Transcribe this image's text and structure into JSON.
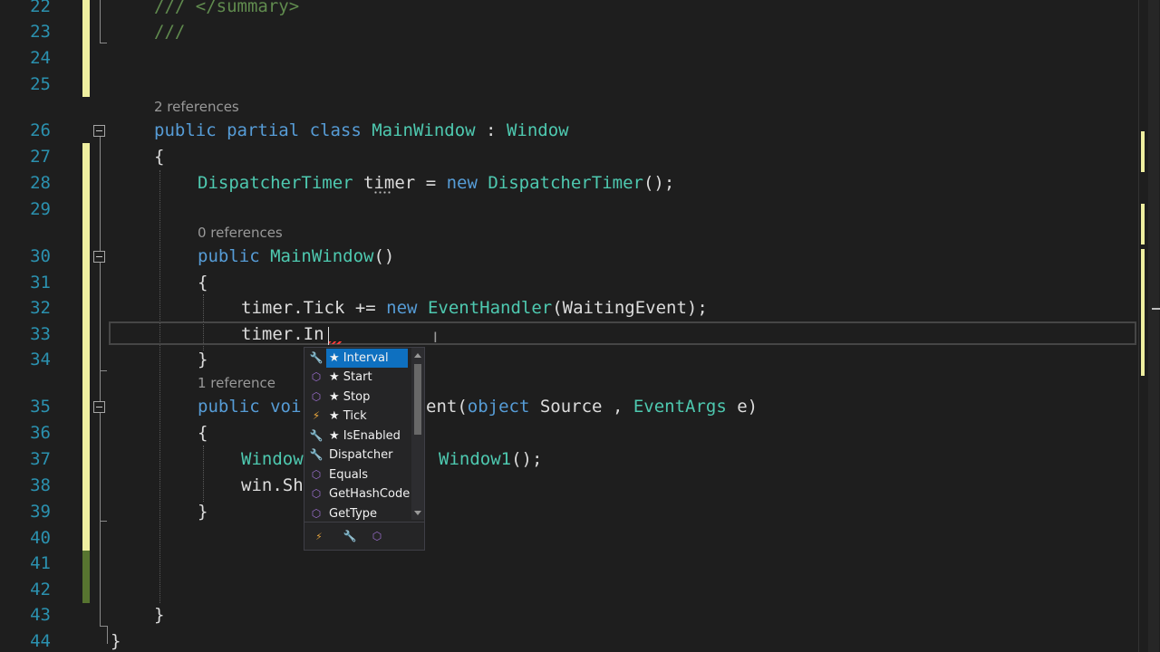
{
  "line_numbers": [
    "22",
    "23",
    "24",
    "25",
    "26",
    "27",
    "28",
    "29",
    "30",
    "31",
    "32",
    "33",
    "34",
    "35",
    "36",
    "37",
    "38",
    "39",
    "40",
    "41",
    "42",
    "43",
    "44"
  ],
  "code_lens": {
    "class_refs": "2 references",
    "ctor_refs": "0 references",
    "method_refs": "1 reference"
  },
  "code": {
    "l22": "/// </summary>",
    "l23": "///",
    "l26": {
      "kw": "public partial class ",
      "name": "MainWindow",
      "sep": " : ",
      "base": "Window"
    },
    "l27": "{",
    "l28": {
      "type": "DispatcherTimer",
      "ws": " ",
      "var": "timer",
      "eq": " = ",
      "kw": "new",
      "sp": " ",
      "ctor": "DispatcherTimer",
      "end": "();"
    },
    "l30": {
      "kw": "public",
      "sp": " ",
      "name": "MainWindow",
      "end": "()"
    },
    "l31": "{",
    "l32": {
      "obj": "timer",
      "rest": ".Tick += ",
      "kw": "new",
      "sp": " ",
      "type": "EventHandler",
      "end": "(WaitingEvent);"
    },
    "l33": "timer.In",
    "l34": "}",
    "l35": {
      "kw": "public",
      "sp": " ",
      "kw2": "voi",
      "tail1": "ent(",
      "kw3": "object",
      "sp2": " ",
      "p1": "Source",
      "mid": " , ",
      "type": "EventArgs",
      "end": " e)"
    },
    "l36": "{",
    "l37": {
      "type": "Window",
      "tail_type": "Window1",
      "end": "();"
    },
    "l38": "win.Sh",
    "l39": "}",
    "l43": "}",
    "l44": "}"
  },
  "intellisense": {
    "items": [
      {
        "label": "★ Interval",
        "icon": "wrench-icon",
        "selected": true
      },
      {
        "label": "★ Start",
        "icon": "method-icon",
        "selected": false
      },
      {
        "label": "★ Stop",
        "icon": "method-icon",
        "selected": false
      },
      {
        "label": "★ Tick",
        "icon": "event-icon",
        "selected": false
      },
      {
        "label": "★ IsEnabled",
        "icon": "wrench-icon",
        "selected": false
      },
      {
        "label": "Dispatcher",
        "icon": "wrench-icon",
        "selected": false
      },
      {
        "label": "Equals",
        "icon": "method-icon",
        "selected": false
      },
      {
        "label": "GetHashCode",
        "icon": "method-icon",
        "selected": false
      },
      {
        "label": "GetType",
        "icon": "method-icon",
        "selected": false
      }
    ],
    "filters": [
      "event-icon",
      "wrench-icon",
      "method-icon"
    ]
  },
  "colors": {
    "keyword": "#569cd6",
    "type": "#4ec9b0",
    "comment": "#57a64a",
    "line_number": "#2b91af",
    "selection": "#0e70c0"
  }
}
